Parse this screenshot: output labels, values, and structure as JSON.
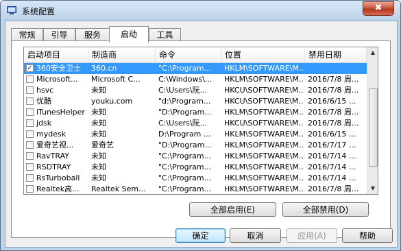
{
  "window": {
    "title": "系统配置",
    "close_label": "✖"
  },
  "tabs": [
    {
      "label": "常规",
      "active": false
    },
    {
      "label": "引导",
      "active": false
    },
    {
      "label": "服务",
      "active": false
    },
    {
      "label": "启动",
      "active": true
    },
    {
      "label": "工具",
      "active": false
    }
  ],
  "table": {
    "columns": [
      "启动项目",
      "制造商",
      "命令",
      "位置",
      "禁用日期"
    ],
    "rows": [
      {
        "checked": true,
        "selected": true,
        "item": "360安全卫士",
        "maker": "360.cn",
        "command": "\"C:\\Program...",
        "location": "HKLM\\SOFTWARE\\M...",
        "date": ""
      },
      {
        "checked": false,
        "selected": false,
        "item": "Microsoft...",
        "maker": "Microsoft C...",
        "command": "C:\\Windows\\...",
        "location": "HKLM\\SOFTWARE\\M...",
        "date": "2016/7/8 周..."
      },
      {
        "checked": false,
        "selected": false,
        "item": "hsvc",
        "maker": "未知",
        "command": "C:\\Users\\阮...",
        "location": "HKCU\\SOFTWARE\\M...",
        "date": "2016/7/8 周..."
      },
      {
        "checked": false,
        "selected": false,
        "item": "优酷",
        "maker": "youku.com",
        "command": "\"d:\\Program...",
        "location": "HKCU\\SOFTWARE\\M...",
        "date": "2016/6/15 ..."
      },
      {
        "checked": false,
        "selected": false,
        "item": "iTunesHelper",
        "maker": "未知",
        "command": "\"D:\\Program...",
        "location": "HKLM\\SOFTWARE\\M...",
        "date": "2016/7/8 周..."
      },
      {
        "checked": false,
        "selected": false,
        "item": "jdsk",
        "maker": "未知",
        "command": "C:\\Users\\阮...",
        "location": "HKCU\\SOFTWARE\\M...",
        "date": "2016/7/8 周..."
      },
      {
        "checked": false,
        "selected": false,
        "item": "mydesk",
        "maker": "未知",
        "command": "D:\\Program ...",
        "location": "HKLM\\SOFTWARE\\M...",
        "date": "2016/6/15 ..."
      },
      {
        "checked": false,
        "selected": false,
        "item": "爱奇艺视...",
        "maker": "爱奇艺",
        "command": "\"D:\\Program...",
        "location": "HKLM\\SOFTWARE\\M...",
        "date": "2016/7/17 ..."
      },
      {
        "checked": false,
        "selected": false,
        "item": "RavTRAY",
        "maker": "未知",
        "command": "\"C:\\Program...",
        "location": "HKLM\\SOFTWARE\\M...",
        "date": "2016/7/14 ..."
      },
      {
        "checked": false,
        "selected": false,
        "item": "RSDTRAY",
        "maker": "未知",
        "command": "\"C:\\Program...",
        "location": "HKLM\\SOFTWARE\\M...",
        "date": "2016/7/14 ..."
      },
      {
        "checked": false,
        "selected": false,
        "item": "RsTurboball",
        "maker": "未知",
        "command": "\"C:\\Program...",
        "location": "HKLM\\SOFTWARE\\M...",
        "date": "2016/7/14 ..."
      },
      {
        "checked": false,
        "selected": false,
        "item": "Realtek高...",
        "maker": "Realtek Sem...",
        "command": "\"C:\\Program...",
        "location": "HKLM\\SOFTWARE\\M...",
        "date": "2016/7/8 周..."
      }
    ]
  },
  "panel_buttons": {
    "enable_all": "全部启用(E)",
    "disable_all": "全部禁用(D)"
  },
  "dialog_buttons": {
    "ok": "确定",
    "cancel": "取消",
    "apply": "应用(A)",
    "help": "帮助"
  },
  "colors": {
    "selection": "#3399ff",
    "titlebar": "#bcd3ec",
    "close": "#c85a41"
  }
}
